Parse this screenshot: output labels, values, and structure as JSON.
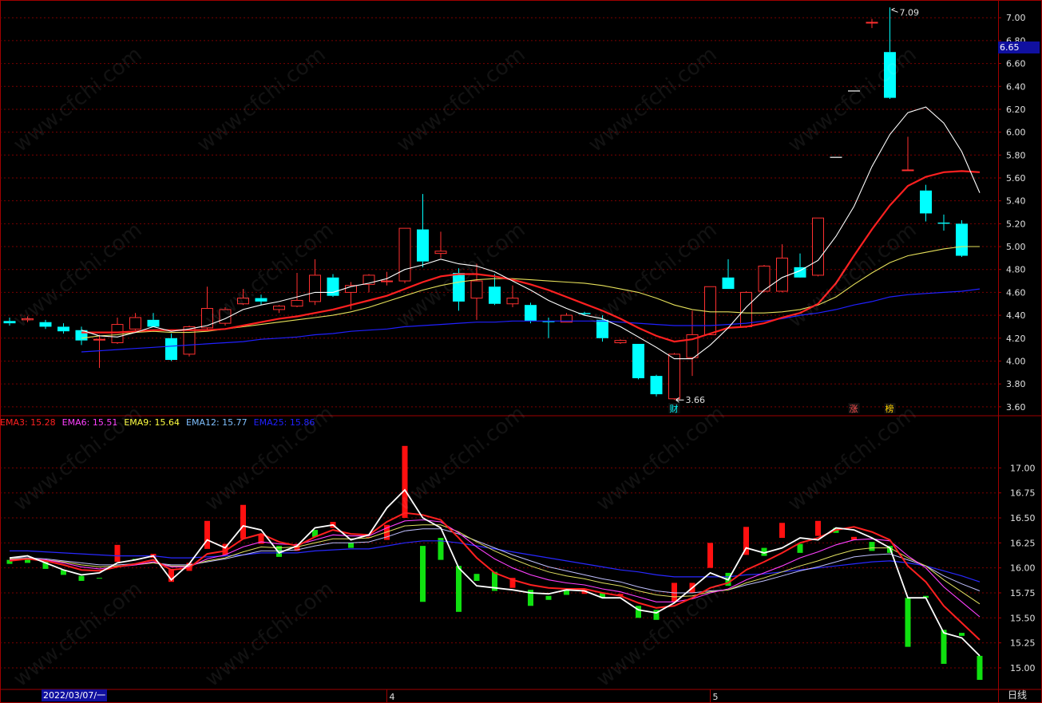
{
  "watermark": "www.cfchi.com",
  "period_label": "日线",
  "current_price_badge": "6.65",
  "cursor_date": "2022/03/07/一",
  "colors": {
    "up": "#ff3030",
    "down": "#00ffff",
    "grid": "#7a0000",
    "frame": "#a00000",
    "ema3": "#ff2020",
    "ema6": "#ff40ff",
    "ema9": "#ffff40",
    "ema12": "#80c0ff",
    "ema25": "#2020ff"
  },
  "chart_data": [
    {
      "type": "candlestick",
      "panel": "price",
      "y_ticks": [
        "7.00",
        "6.80",
        "6.60",
        "6.40",
        "6.20",
        "6.00",
        "5.80",
        "5.60",
        "5.40",
        "5.20",
        "5.00",
        "4.80",
        "4.60",
        "4.40",
        "4.20",
        "4.00",
        "3.80",
        "3.60"
      ],
      "ylim": [
        3.55,
        7.12
      ],
      "x_ticks": [
        "4",
        "5"
      ],
      "annotations": {
        "high": "7.09",
        "low": "3.66"
      },
      "event_markers": [
        "财",
        "涨",
        "榜"
      ],
      "candles": [
        {
          "o": 4.35,
          "h": 4.38,
          "l": 4.31,
          "c": 4.33
        },
        {
          "o": 4.36,
          "h": 4.39,
          "l": 4.34,
          "c": 4.37
        },
        {
          "o": 4.34,
          "h": 4.36,
          "l": 4.28,
          "c": 4.3
        },
        {
          "o": 4.3,
          "h": 4.33,
          "l": 4.24,
          "c": 4.26
        },
        {
          "o": 4.27,
          "h": 4.3,
          "l": 4.14,
          "c": 4.18
        },
        {
          "o": 4.19,
          "h": 4.23,
          "l": 3.94,
          "c": 4.19
        },
        {
          "o": 4.16,
          "h": 4.38,
          "l": 4.15,
          "c": 4.32
        },
        {
          "o": 4.28,
          "h": 4.42,
          "l": 4.27,
          "c": 4.38
        },
        {
          "o": 4.36,
          "h": 4.42,
          "l": 4.3,
          "c": 4.3
        },
        {
          "o": 4.2,
          "h": 4.24,
          "l": 4.0,
          "c": 4.01
        },
        {
          "o": 4.06,
          "h": 4.31,
          "l": 4.04,
          "c": 4.3
        },
        {
          "o": 4.29,
          "h": 4.65,
          "l": 4.27,
          "c": 4.46
        },
        {
          "o": 4.33,
          "h": 4.47,
          "l": 4.31,
          "c": 4.45
        },
        {
          "o": 4.5,
          "h": 4.63,
          "l": 4.49,
          "c": 4.55
        },
        {
          "o": 4.55,
          "h": 4.58,
          "l": 4.49,
          "c": 4.52
        },
        {
          "o": 4.45,
          "h": 4.49,
          "l": 4.42,
          "c": 4.48
        },
        {
          "o": 4.48,
          "h": 4.77,
          "l": 4.47,
          "c": 4.53
        },
        {
          "o": 4.52,
          "h": 4.89,
          "l": 4.49,
          "c": 4.75
        },
        {
          "o": 4.73,
          "h": 4.76,
          "l": 4.56,
          "c": 4.57
        },
        {
          "o": 4.6,
          "h": 4.69,
          "l": 4.45,
          "c": 4.66
        },
        {
          "o": 4.67,
          "h": 4.76,
          "l": 4.6,
          "c": 4.75
        },
        {
          "o": 4.7,
          "h": 4.78,
          "l": 4.66,
          "c": 4.7
        },
        {
          "o": 4.7,
          "h": 5.16,
          "l": 4.68,
          "c": 5.16
        },
        {
          "o": 5.15,
          "h": 5.46,
          "l": 4.82,
          "c": 4.87
        },
        {
          "o": 4.94,
          "h": 5.13,
          "l": 4.9,
          "c": 4.96
        },
        {
          "o": 4.77,
          "h": 4.81,
          "l": 4.44,
          "c": 4.52
        },
        {
          "o": 4.55,
          "h": 4.85,
          "l": 4.36,
          "c": 4.7
        },
        {
          "o": 4.65,
          "h": 4.76,
          "l": 4.49,
          "c": 4.5
        },
        {
          "o": 4.5,
          "h": 4.66,
          "l": 4.47,
          "c": 4.55
        },
        {
          "o": 4.49,
          "h": 4.51,
          "l": 4.33,
          "c": 4.35
        },
        {
          "o": 4.35,
          "h": 4.38,
          "l": 4.2,
          "c": 4.34
        },
        {
          "o": 4.34,
          "h": 4.42,
          "l": 4.34,
          "c": 4.4
        },
        {
          "o": 4.42,
          "h": 4.43,
          "l": 4.4,
          "c": 4.41
        },
        {
          "o": 4.36,
          "h": 4.4,
          "l": 4.17,
          "c": 4.2
        },
        {
          "o": 4.16,
          "h": 4.19,
          "l": 4.15,
          "c": 4.18
        },
        {
          "o": 4.15,
          "h": 4.15,
          "l": 3.84,
          "c": 3.85
        },
        {
          "o": 3.87,
          "h": 3.88,
          "l": 3.69,
          "c": 3.71
        },
        {
          "o": 3.67,
          "h": 4.07,
          "l": 3.66,
          "c": 4.06
        },
        {
          "o": 4.03,
          "h": 4.44,
          "l": 3.87,
          "c": 4.23
        },
        {
          "o": 4.23,
          "h": 4.65,
          "l": 4.23,
          "c": 4.65
        },
        {
          "o": 4.73,
          "h": 4.89,
          "l": 4.63,
          "c": 4.63
        },
        {
          "o": 4.3,
          "h": 4.61,
          "l": 4.29,
          "c": 4.6
        },
        {
          "o": 4.61,
          "h": 4.84,
          "l": 4.6,
          "c": 4.83
        },
        {
          "o": 4.61,
          "h": 5.02,
          "l": 4.6,
          "c": 4.9
        },
        {
          "o": 4.82,
          "h": 4.94,
          "l": 4.74,
          "c": 4.73
        },
        {
          "o": 4.75,
          "h": 5.25,
          "l": 4.74,
          "c": 5.25
        },
        {
          "o": 5.78,
          "h": 5.78,
          "l": 5.78,
          "c": 5.78
        },
        {
          "o": 6.36,
          "h": 6.36,
          "l": 6.36,
          "c": 6.36
        },
        {
          "o": 6.96,
          "h": 6.99,
          "l": 6.91,
          "c": 6.96
        },
        {
          "o": 6.7,
          "h": 7.09,
          "l": 6.29,
          "c": 6.3
        },
        {
          "o": 5.67,
          "h": 5.96,
          "l": 5.67,
          "c": 5.67
        },
        {
          "o": 5.49,
          "h": 5.54,
          "l": 5.22,
          "c": 5.29
        },
        {
          "o": 5.21,
          "h": 5.28,
          "l": 5.14,
          "c": 5.2
        },
        {
          "o": 5.2,
          "h": 5.23,
          "l": 4.91,
          "c": 4.92
        }
      ],
      "ma_white": [
        null,
        null,
        null,
        null,
        4.27,
        4.22,
        4.21,
        4.25,
        4.3,
        4.26,
        4.28,
        4.31,
        4.37,
        4.45,
        4.49,
        4.52,
        4.56,
        4.6,
        4.6,
        4.65,
        4.68,
        4.72,
        4.8,
        4.84,
        4.89,
        4.85,
        4.83,
        4.78,
        4.7,
        4.62,
        4.53,
        4.46,
        4.4,
        4.37,
        4.3,
        4.21,
        4.12,
        4.02,
        4.02,
        4.14,
        4.29,
        4.47,
        4.62,
        4.73,
        4.79,
        4.88,
        5.09,
        5.35,
        5.7,
        5.98,
        6.17,
        6.22,
        6.08,
        5.83,
        5.47
      ],
      "ma_red": [
        null,
        null,
        null,
        null,
        4.25,
        4.25,
        4.25,
        4.26,
        4.27,
        4.27,
        4.27,
        4.27,
        4.28,
        4.31,
        4.34,
        4.37,
        4.39,
        4.42,
        4.45,
        4.49,
        4.53,
        4.57,
        4.63,
        4.69,
        4.74,
        4.76,
        4.76,
        4.74,
        4.71,
        4.67,
        4.62,
        4.56,
        4.5,
        4.44,
        4.37,
        4.29,
        4.22,
        4.17,
        4.19,
        4.24,
        4.29,
        4.3,
        4.33,
        4.38,
        4.42,
        4.5,
        4.68,
        4.92,
        5.15,
        5.36,
        5.53,
        5.61,
        5.65,
        5.66,
        5.65
      ],
      "ma_yellow": [
        null,
        null,
        null,
        null,
        4.2,
        4.22,
        4.23,
        4.25,
        4.26,
        4.25,
        4.25,
        4.26,
        4.28,
        4.3,
        4.32,
        4.34,
        4.36,
        4.38,
        4.4,
        4.43,
        4.47,
        4.52,
        4.57,
        4.62,
        4.66,
        4.69,
        4.71,
        4.72,
        4.72,
        4.71,
        4.7,
        4.69,
        4.68,
        4.66,
        4.63,
        4.6,
        4.55,
        4.49,
        4.45,
        4.43,
        4.43,
        4.42,
        4.42,
        4.43,
        4.45,
        4.49,
        4.56,
        4.67,
        4.77,
        4.86,
        4.92,
        4.95,
        4.98,
        5.0,
        5.0
      ],
      "ma_blue": [
        null,
        null,
        null,
        null,
        4.08,
        4.09,
        4.1,
        4.11,
        4.12,
        4.13,
        4.14,
        4.15,
        4.16,
        4.17,
        4.19,
        4.2,
        4.21,
        4.23,
        4.24,
        4.26,
        4.27,
        4.28,
        4.3,
        4.31,
        4.32,
        4.33,
        4.34,
        4.34,
        4.35,
        4.35,
        4.35,
        4.35,
        4.35,
        4.35,
        4.34,
        4.33,
        4.32,
        4.31,
        4.31,
        4.31,
        4.32,
        4.33,
        4.35,
        4.37,
        4.4,
        4.42,
        4.45,
        4.49,
        4.52,
        4.56,
        4.58,
        4.59,
        4.6,
        4.61,
        4.63
      ]
    },
    {
      "type": "bar+line",
      "panel": "ema",
      "legend": [
        {
          "name": "EMA3",
          "value": "15.28"
        },
        {
          "name": "EMA6",
          "value": "15.51"
        },
        {
          "name": "EMA9",
          "value": "15.64"
        },
        {
          "name": "EMA12",
          "value": "15.77"
        },
        {
          "name": "EMA25",
          "value": "15.86"
        }
      ],
      "y_ticks": [
        "17.00",
        "16.75",
        "16.50",
        "16.25",
        "16.00",
        "15.75",
        "15.50",
        "15.25",
        "15.00"
      ],
      "ylim": [
        14.8,
        17.45
      ],
      "closes": [
        16.1,
        16.12,
        16.05,
        15.98,
        15.93,
        15.95,
        16.05,
        16.08,
        16.12,
        15.88,
        16.04,
        16.28,
        16.2,
        16.42,
        16.38,
        16.15,
        16.22,
        16.4,
        16.43,
        16.28,
        16.33,
        16.6,
        16.78,
        16.5,
        16.4,
        16.0,
        15.82,
        15.8,
        15.78,
        15.75,
        15.74,
        15.78,
        15.77,
        15.7,
        15.7,
        15.58,
        15.55,
        15.65,
        15.8,
        15.95,
        15.88,
        16.2,
        16.15,
        16.2,
        16.3,
        16.28,
        16.4,
        16.38,
        16.3,
        16.2,
        15.7,
        15.7,
        15.35,
        15.3,
        15.12
      ],
      "bar_ends": [
        [
          16.08,
          16.04
        ],
        [
          16.1,
          16.05
        ],
        [
          16.06,
          15.99
        ],
        [
          15.98,
          15.93
        ],
        [
          15.92,
          15.87
        ],
        [
          15.9,
          15.9
        ],
        [
          16.06,
          16.23
        ],
        [
          16.09,
          16.08
        ],
        [
          16.1,
          16.14
        ],
        [
          15.86,
          15.99
        ],
        [
          15.97,
          16.05
        ],
        [
          16.19,
          16.47
        ],
        [
          16.13,
          16.24
        ],
        [
          16.29,
          16.63
        ],
        [
          16.24,
          16.34
        ],
        [
          16.22,
          16.11
        ],
        [
          16.17,
          16.24
        ],
        [
          16.38,
          16.31
        ],
        [
          16.4,
          16.46
        ],
        [
          16.25,
          16.2
        ],
        [
          16.3,
          16.31
        ],
        [
          16.28,
          16.43
        ],
        [
          16.5,
          17.22
        ],
        [
          16.22,
          15.66
        ],
        [
          16.3,
          16.08
        ],
        [
          16.02,
          15.56
        ],
        [
          15.94,
          15.87
        ],
        [
          15.96,
          15.77
        ],
        [
          15.8,
          15.9
        ],
        [
          15.78,
          15.62
        ],
        [
          15.72,
          15.68
        ],
        [
          15.78,
          15.73
        ],
        [
          15.74,
          15.79
        ],
        [
          15.75,
          15.7
        ],
        [
          15.72,
          15.74
        ],
        [
          15.62,
          15.5
        ],
        [
          15.58,
          15.48
        ],
        [
          15.66,
          15.85
        ],
        [
          15.75,
          15.85
        ],
        [
          16.0,
          16.25
        ],
        [
          15.95,
          15.82
        ],
        [
          16.13,
          16.41
        ],
        [
          16.2,
          16.12
        ],
        [
          16.3,
          16.45
        ],
        [
          16.24,
          16.15
        ],
        [
          16.32,
          16.47
        ],
        [
          16.4,
          16.35
        ],
        [
          16.28,
          16.31
        ],
        [
          16.26,
          16.17
        ],
        [
          16.22,
          16.15
        ],
        [
          15.7,
          15.21
        ],
        [
          15.72,
          15.7
        ],
        [
          15.38,
          15.04
        ],
        [
          15.35,
          15.32
        ],
        [
          15.12,
          14.88
        ]
      ],
      "ema3": [
        16.07,
        16.09,
        16.07,
        16.03,
        15.98,
        15.97,
        16.01,
        16.04,
        16.08,
        15.98,
        16.0,
        16.14,
        16.17,
        16.29,
        16.34,
        16.26,
        16.22,
        16.31,
        16.38,
        16.34,
        16.33,
        16.46,
        16.55,
        16.53,
        16.48,
        16.3,
        16.1,
        15.95,
        15.88,
        15.83,
        15.8,
        15.79,
        15.79,
        15.75,
        15.72,
        15.65,
        15.6,
        15.62,
        15.7,
        15.8,
        15.85,
        15.98,
        16.06,
        16.15,
        16.25,
        16.3,
        16.38,
        16.41,
        16.36,
        16.28,
        16.02,
        15.86,
        15.62,
        15.45,
        15.28
      ],
      "ema6": [
        16.08,
        16.09,
        16.08,
        16.05,
        16.01,
        15.99,
        16.01,
        16.03,
        16.06,
        16.01,
        16.01,
        16.09,
        16.13,
        16.21,
        16.26,
        16.24,
        16.23,
        16.28,
        16.33,
        16.32,
        16.32,
        16.4,
        16.47,
        16.48,
        16.46,
        16.35,
        16.21,
        16.09,
        16.0,
        15.93,
        15.88,
        15.85,
        15.83,
        15.79,
        15.76,
        15.71,
        15.66,
        15.66,
        15.69,
        15.75,
        15.79,
        15.88,
        15.95,
        16.02,
        16.1,
        16.16,
        16.23,
        16.28,
        16.29,
        16.27,
        16.12,
        16.0,
        15.81,
        15.66,
        15.51
      ],
      "ema9": [
        16.09,
        16.09,
        16.08,
        16.06,
        16.03,
        16.01,
        16.02,
        16.03,
        16.05,
        16.02,
        16.02,
        16.07,
        16.1,
        16.16,
        16.21,
        16.2,
        16.21,
        16.25,
        16.29,
        16.29,
        16.3,
        16.36,
        16.42,
        16.43,
        16.43,
        16.36,
        16.26,
        16.17,
        16.09,
        16.02,
        15.96,
        15.92,
        15.89,
        15.85,
        15.82,
        15.77,
        15.73,
        15.71,
        15.72,
        15.76,
        15.78,
        15.85,
        15.9,
        15.96,
        16.02,
        16.07,
        16.13,
        16.18,
        16.2,
        16.2,
        16.1,
        16.02,
        15.88,
        15.76,
        15.64
      ],
      "ema12": [
        16.1,
        16.1,
        16.09,
        16.07,
        16.05,
        16.03,
        16.03,
        16.04,
        16.05,
        16.03,
        16.03,
        16.06,
        16.09,
        16.13,
        16.17,
        16.17,
        16.18,
        16.22,
        16.25,
        16.25,
        16.26,
        16.31,
        16.37,
        16.39,
        16.39,
        16.34,
        16.27,
        16.2,
        16.13,
        16.07,
        16.01,
        15.97,
        15.93,
        15.89,
        15.86,
        15.81,
        15.77,
        15.75,
        15.75,
        15.77,
        15.78,
        15.83,
        15.87,
        15.92,
        15.97,
        16.01,
        16.06,
        16.11,
        16.13,
        16.14,
        16.08,
        16.02,
        15.92,
        15.84,
        15.77
      ],
      "ema25": [
        16.17,
        16.17,
        16.16,
        16.15,
        16.14,
        16.13,
        16.12,
        16.12,
        16.12,
        16.1,
        16.1,
        16.11,
        16.12,
        16.13,
        16.15,
        16.15,
        16.15,
        16.17,
        16.18,
        16.19,
        16.19,
        16.22,
        16.25,
        16.27,
        16.27,
        16.25,
        16.22,
        16.19,
        16.16,
        16.13,
        16.1,
        16.07,
        16.04,
        16.01,
        15.98,
        15.96,
        15.93,
        15.91,
        15.91,
        15.91,
        15.91,
        15.93,
        15.94,
        15.96,
        15.98,
        16.0,
        16.02,
        16.04,
        16.06,
        16.07,
        16.05,
        16.02,
        15.97,
        15.92,
        15.86
      ]
    }
  ]
}
